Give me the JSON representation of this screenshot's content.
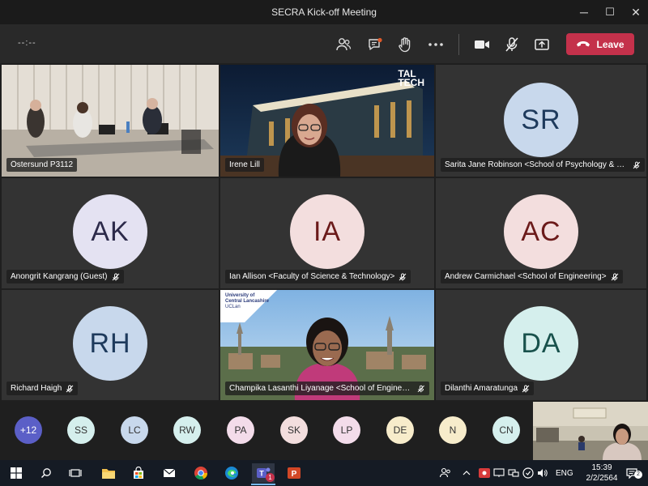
{
  "window": {
    "title": "SECRA Kick-off Meeting",
    "minimize": "─",
    "maximize": "☐",
    "close": "✕"
  },
  "toolbar": {
    "timer": "--:--",
    "leave_label": "Leave",
    "leave_color": "#c4314b"
  },
  "tiles": [
    {
      "type": "video",
      "name": "Östersund P3112",
      "scene": "room"
    },
    {
      "type": "video",
      "name": "Irene Lill",
      "scene": "taltech",
      "logo_line1": "TAL",
      "logo_line2": "TECH"
    },
    {
      "type": "avatar",
      "initials": "SR",
      "name": "Sarita Jane Robinson <School of Psychology & Co...",
      "muted": true,
      "bg": "#c8d8ec",
      "fg": "#1e3a5c"
    },
    {
      "type": "avatar",
      "initials": "AK",
      "name": "Anongrit Kangrang (Guest)",
      "muted": true,
      "bg": "#e4e2f2",
      "fg": "#2c2a4a"
    },
    {
      "type": "avatar",
      "initials": "IA",
      "name": "Ian Allison <Faculty of Science & Technology>",
      "muted": true,
      "bg": "#f3dede",
      "fg": "#6b1a1a"
    },
    {
      "type": "avatar",
      "initials": "AC",
      "name": "Andrew Carmichael <School of Engineering>",
      "muted": true,
      "bg": "#f3dede",
      "fg": "#6b1a1a"
    },
    {
      "type": "avatar",
      "initials": "RH",
      "name": "Richard Haigh",
      "muted": true,
      "bg": "#c8d8ec",
      "fg": "#1e3a5c"
    },
    {
      "type": "video",
      "name": "Champika Lasanthi Liyanage <School of Engineerin...",
      "muted": true,
      "scene": "uclan",
      "logo_line1": "University of",
      "logo_line2": "Central Lancashire",
      "logo_line3": "UCLan"
    },
    {
      "type": "avatar",
      "initials": "DA",
      "name": "Dilanthi Amaratunga",
      "muted": true,
      "bg": "#d5efed",
      "fg": "#18514c"
    }
  ],
  "overflow_count": "+12",
  "participants": [
    {
      "initials": "SS",
      "bg": "#d5efed"
    },
    {
      "initials": "LC",
      "bg": "#c8d8ec"
    },
    {
      "initials": "RW",
      "bg": "#d5efed"
    },
    {
      "initials": "PA",
      "bg": "#f3dcea"
    },
    {
      "initials": "SK",
      "bg": "#f3dede"
    },
    {
      "initials": "LP",
      "bg": "#f3dcea"
    },
    {
      "initials": "DE",
      "bg": "#f7eccb"
    },
    {
      "initials": "N",
      "bg": "#f7eccb"
    },
    {
      "initials": "CN",
      "bg": "#d5efed"
    }
  ],
  "taskbar": {
    "teams_badge": "1",
    "language": "ENG",
    "time": "15:39",
    "date": "2/2/2564",
    "notification_count": "2"
  }
}
